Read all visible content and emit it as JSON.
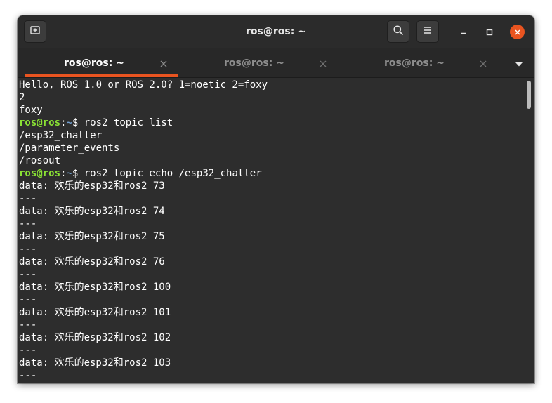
{
  "window": {
    "title": "ros@ros: ~"
  },
  "tabs": [
    {
      "label": "ros@ros: ~",
      "active": true
    },
    {
      "label": "ros@ros: ~",
      "active": false
    },
    {
      "label": "ros@ros: ~",
      "active": false
    }
  ],
  "terminal": {
    "prompt": {
      "user": "ros@ros",
      "sep": ":",
      "path": "~",
      "symbol": "$"
    },
    "lines": [
      {
        "text": "Hello, ROS 1.0 or ROS 2.0? 1=noetic 2=foxy"
      },
      {
        "text": "2"
      },
      {
        "text": "foxy"
      },
      {
        "command": " ros2 topic list"
      },
      {
        "text": "/esp32_chatter"
      },
      {
        "text": "/parameter_events"
      },
      {
        "text": "/rosout"
      },
      {
        "command": " ros2 topic echo /esp32_chatter"
      },
      {
        "text": "data: 欢乐的esp32和ros2 73"
      },
      {
        "text": "---"
      },
      {
        "text": "data: 欢乐的esp32和ros2 74"
      },
      {
        "text": "---"
      },
      {
        "text": "data: 欢乐的esp32和ros2 75"
      },
      {
        "text": "---"
      },
      {
        "text": "data: 欢乐的esp32和ros2 76"
      },
      {
        "text": "---"
      },
      {
        "text": "data: 欢乐的esp32和ros2 100"
      },
      {
        "text": "---"
      },
      {
        "text": "data: 欢乐的esp32和ros2 101"
      },
      {
        "text": "---"
      },
      {
        "text": "data: 欢乐的esp32和ros2 102"
      },
      {
        "text": "---"
      },
      {
        "text": "data: 欢乐的esp32和ros2 103"
      },
      {
        "text": "---"
      }
    ]
  },
  "colors": {
    "accent": "#e95420",
    "prompt_user": "#8ae234",
    "prompt_path": "#729fcf",
    "terminal_bg": "#2d2d2d"
  },
  "icons": {
    "new_tab": "new-tab-icon",
    "search": "search-icon",
    "menu": "hamburger-menu-icon",
    "minimize": "minimize-icon",
    "maximize": "maximize-icon",
    "close": "close-icon",
    "tab_dropdown": "chevron-down-icon"
  }
}
